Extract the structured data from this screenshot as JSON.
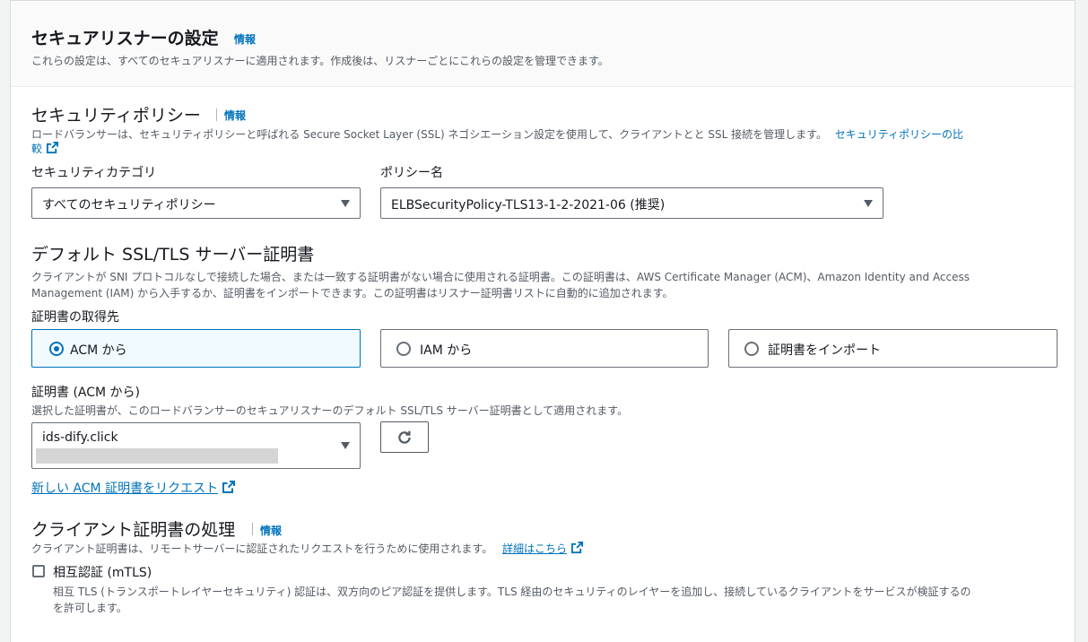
{
  "listener_settings": {
    "title": "セキュアリスナーの設定",
    "info": "情報",
    "description": "これらの設定は、すべてのセキュアリスナーに適用されます。作成後は、リスナーごとにこれらの設定を管理できます。"
  },
  "security_policy": {
    "title": "セキュリティポリシー",
    "info": "情報",
    "description": "ロードバランサーは、セキュリティポリシーと呼ばれる Secure Socket Layer (SSL) ネゴシエーション設定を使用して、クライアントとと SSL 接続を管理します。",
    "compare_link_line1": "セキュリティポリシーの比",
    "compare_link_line2": "較",
    "category_label": "セキュリティカテゴリ",
    "category_value": "すべてのセキュリティポリシー",
    "policy_label": "ポリシー名",
    "policy_value": "ELBSecurityPolicy-TLS13-1-2-2021-06 (推奨)"
  },
  "default_cert": {
    "title": "デフォルト SSL/TLS サーバー証明書",
    "description_line1": "クライアントが SNI プロトコルなしで接続した場合、または一致する証明書がない場合に使用される証明書。この証明書は、AWS Certificate Manager (ACM)、Amazon Identity and Access",
    "description_line2": "Management (IAM) から入手するか、証明書をインポートできます。この証明書はリスナー証明書リストに自動的に追加されます。",
    "source_label": "証明書の取得先",
    "options": [
      {
        "label": "ACM から",
        "selected": true
      },
      {
        "label": "IAM から",
        "selected": false
      },
      {
        "label": "証明書をインポート",
        "selected": false
      }
    ],
    "cert_label": "証明書 (ACM から)",
    "cert_description": "選択した証明書が、このロードバランサーのセキュアリスナーのデフォルト SSL/TLS サーバー証明書として適用されます。",
    "cert_value": "ids-dify.click",
    "request_link": "新しい ACM 証明書をリクエスト"
  },
  "client_cert": {
    "title": "クライアント証明書の処理",
    "info": "情報",
    "description": "クライアント証明書は、リモートサーバーに認証されたリクエストを行うために使用されます。",
    "details_link": "詳細はこちら",
    "mtls_label": "相互認証 (mTLS)",
    "mtls_checked": false,
    "mtls_description_line1": "相互 TLS (トランスポートレイヤーセキュリティ) 認証は、双方向のピア認証を提供します。TLS 経由のセキュリティのレイヤーを追加し、接続しているクライアントをサービスが検証するの",
    "mtls_description_line2": "を許可します。"
  },
  "colors": {
    "accent": "#0073bb",
    "text": "#16191f",
    "muted": "#545b64",
    "border": "#687078"
  },
  "icons": {
    "external": "external-link-icon",
    "refresh": "refresh-icon",
    "caret": "caret-down-icon"
  }
}
